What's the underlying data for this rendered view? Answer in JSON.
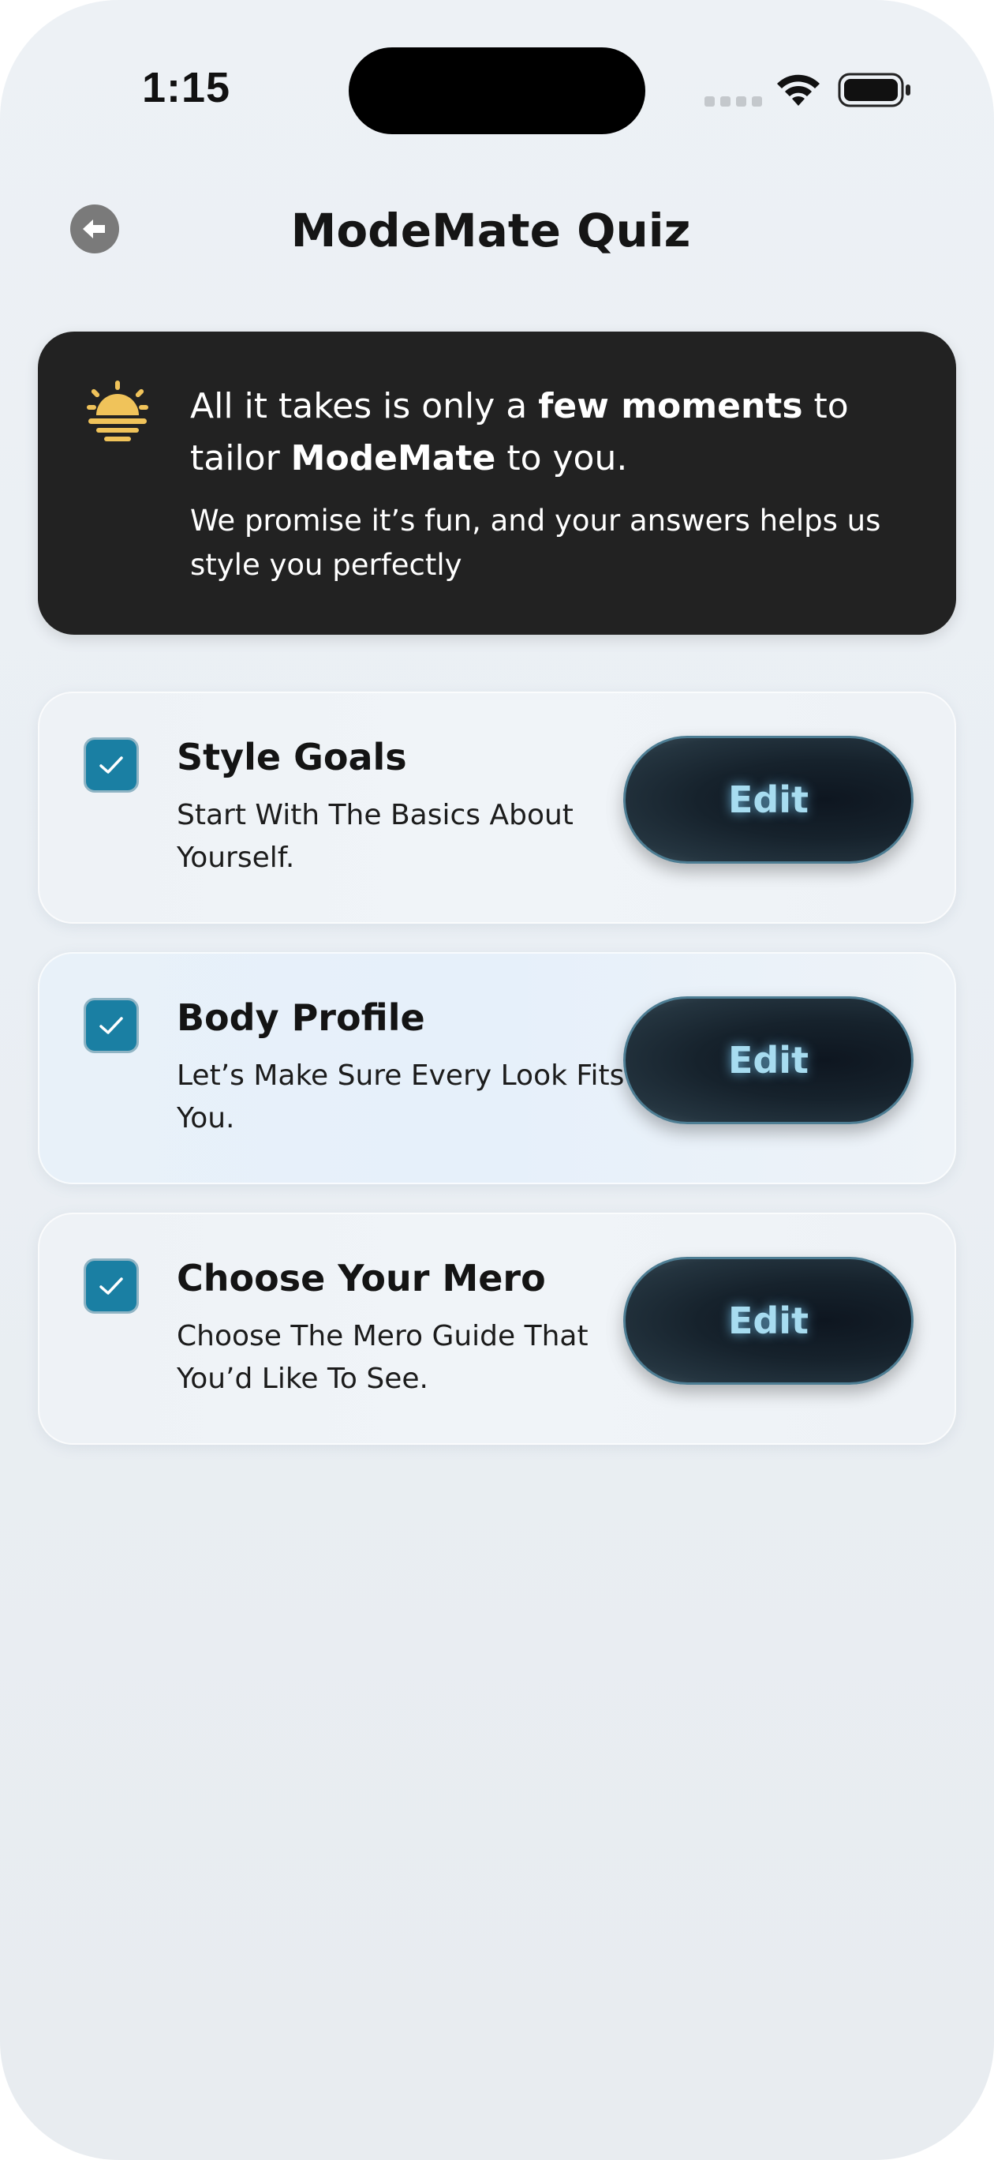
{
  "status_bar": {
    "time": "1:15"
  },
  "header": {
    "title": "ModeMate Quiz"
  },
  "intro": {
    "headline_part1": "All it takes is only a ",
    "headline_bold1": "few moments",
    "headline_part2": " to tailor ",
    "headline_bold2": "ModeMate",
    "headline_part3": " to you.",
    "subtext": "We promise it’s fun, and your answers helps us style you perfectly"
  },
  "quiz_sections": [
    {
      "title": "Style Goals",
      "description": "Start With The Basics About Yourself.",
      "checked": true,
      "button_label": "Edit"
    },
    {
      "title": "Body Profile",
      "description": "Let’s Make Sure Every Look Fits You.",
      "checked": true,
      "button_label": "Edit"
    },
    {
      "title": "Choose Your Mero",
      "description": "Choose The Mero Guide That You’d Like To See.",
      "checked": true,
      "button_label": "Edit"
    }
  ],
  "colors": {
    "accent_checkbox": "#1a7fa3",
    "intro_card_bg": "#222222",
    "sun_icon": "#f0c35a",
    "edit_text": "#a7dcf0"
  },
  "icons": {
    "back": "back-arrow-icon",
    "intro": "sunrise-icon",
    "check": "checkmark-icon"
  }
}
